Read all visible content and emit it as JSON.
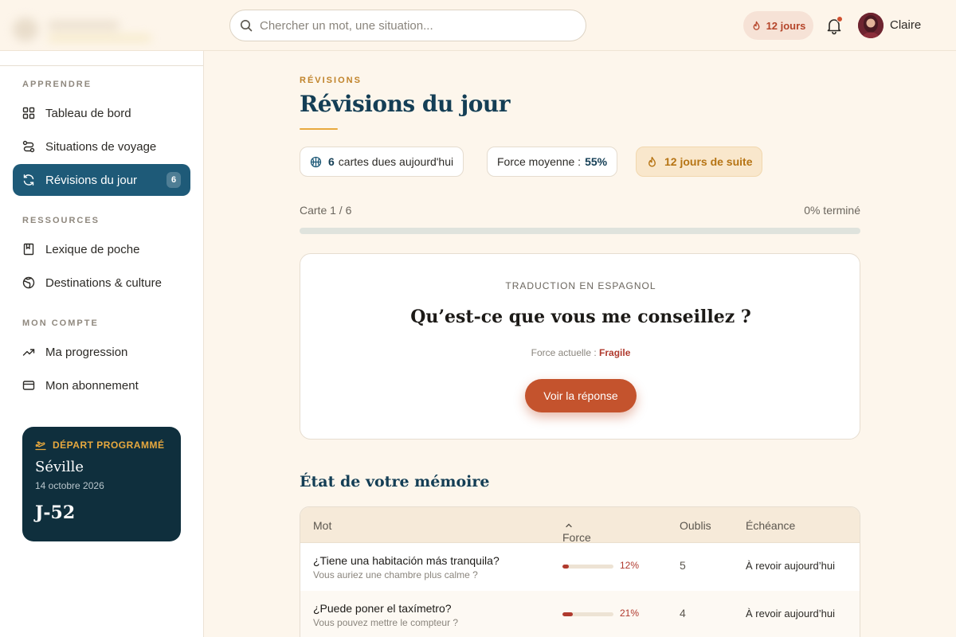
{
  "header": {
    "search_placeholder": "Chercher un mot, une situation...",
    "streak_label": "12 jours",
    "user_name": "Claire"
  },
  "sidebar": {
    "sections": {
      "learn": "APPRENDRE",
      "resources": "RESSOURCES",
      "account": "MON COMPTE"
    },
    "items": [
      {
        "label": "Tableau de bord",
        "icon": "grid-icon"
      },
      {
        "label": "Situations de voyage",
        "icon": "route-icon"
      },
      {
        "label": "Révisions du jour",
        "icon": "refresh-icon",
        "badge": "6",
        "active": true
      },
      {
        "label": "Lexique de poche",
        "icon": "book-icon"
      },
      {
        "label": "Destinations & culture",
        "icon": "globe-icon"
      },
      {
        "label": "Ma progression",
        "icon": "trend-up-icon"
      },
      {
        "label": "Mon abonnement",
        "icon": "credit-card-icon"
      }
    ],
    "trip": {
      "heading": "DÉPART PROGRAMMÉ",
      "city": "Séville",
      "date": "14 octobre 2026",
      "countdown": "J-52"
    }
  },
  "main": {
    "eyebrow": "RÉVISIONS",
    "title": "Révisions du jour",
    "stats": {
      "due_count": "6",
      "due_text": "cartes dues aujourd'hui",
      "avg_label": "Force moyenne :",
      "avg_value": "55%",
      "streak": "12 jours de suite"
    },
    "progress": {
      "label": "Carte 1 / 6",
      "percent_label": "0% terminé",
      "fraction": 0
    },
    "card": {
      "label": "TRADUCTION EN ESPAGNOL",
      "question": "Qu’est-ce que vous me conseillez ?",
      "strength_label": "Force actuelle :",
      "strength_value": "Fragile",
      "reveal_button": "Voir la réponse"
    },
    "memory": {
      "title": "État de votre mémoire",
      "columns": {
        "word": "Mot",
        "strength": "Force",
        "fails": "Oublis",
        "due": "Échéance"
      },
      "rows": [
        {
          "word": "¿Tiene una habitación más tranquila?",
          "translation": "Vous auriez une chambre plus calme ?",
          "strength": 12,
          "strength_label": "12%",
          "fails": "5",
          "due": "À revoir aujourd’hui"
        },
        {
          "word": "¿Puede poner el taxímetro?",
          "translation": "Vous pouvez mettre le compteur ?",
          "strength": 21,
          "strength_label": "21%",
          "fails": "4",
          "due": "À revoir aujourd’hui"
        }
      ]
    }
  },
  "colors": {
    "primary": "#1e5a78",
    "accent": "#c4532d",
    "gold": "#e8a93e",
    "danger": "#b03a2e",
    "background": "#fdf6ec"
  }
}
